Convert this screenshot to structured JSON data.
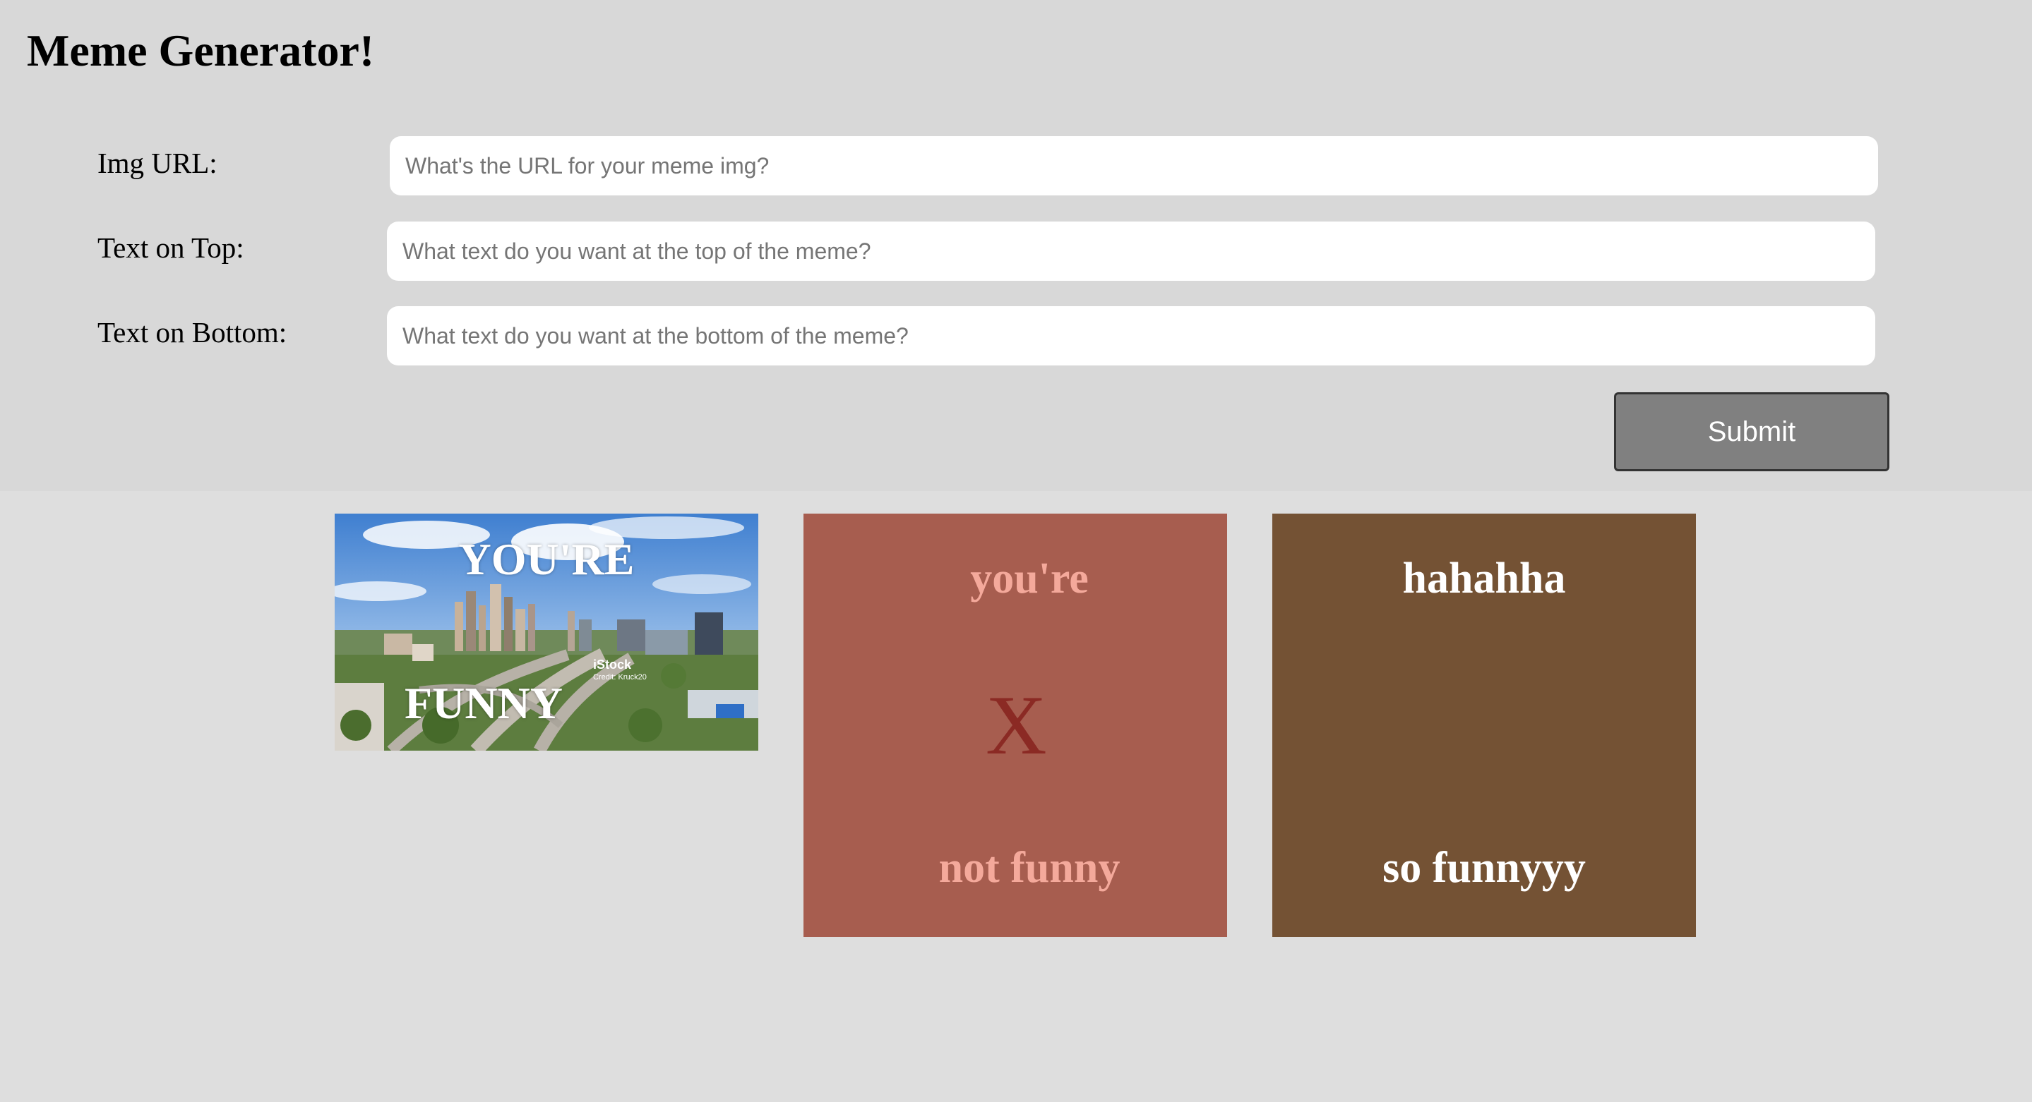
{
  "header": {
    "title": "Meme Generator!"
  },
  "form": {
    "img_url": {
      "label": "Img URL:",
      "value": "",
      "placeholder": "What's the URL for your meme img?"
    },
    "top_text": {
      "label": "Text on Top:",
      "value": "",
      "placeholder": "What text do you want at the top of the meme?"
    },
    "bottom_text": {
      "label": "Text on Bottom:",
      "value": "",
      "placeholder": "What text do you want at the bottom of the meme?"
    },
    "submit_label": "Submit"
  },
  "memes": [
    {
      "kind": "photo",
      "top_text": "YOU'RE",
      "bottom_text": "FUNNY",
      "watermark": "iStock",
      "credit": "Credit: Kruck20",
      "text_color": "#ffffff"
    },
    {
      "kind": "solid",
      "background": "#a75d4f",
      "top_text": "you're",
      "bottom_text": "not funny",
      "text_color": "#f4a99b",
      "delete_label": "X",
      "delete_color": "#8b2a24"
    },
    {
      "kind": "solid",
      "background": "#745234",
      "top_text": "hahahha",
      "bottom_text": "so funnyyy",
      "text_color": "#ffffff"
    }
  ]
}
